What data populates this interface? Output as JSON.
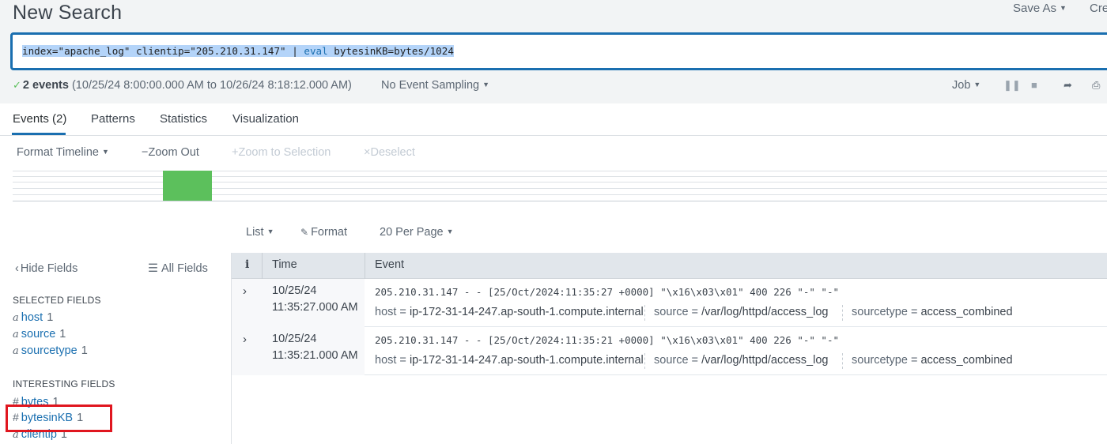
{
  "header": {
    "title": "New Search",
    "save_as": "Save As",
    "create": "Cre"
  },
  "search": {
    "query_part1": "index=\"apache_log\" clientip=\"205.210.31.147\" | ",
    "query_kw": "eval",
    "query_part2": " bytesinKB=bytes/1024"
  },
  "status": {
    "count": "2 events",
    "range": " (10/25/24 8:00:00.000 AM to 10/26/24 8:18:12.000 AM)",
    "sampling": "No Event Sampling",
    "job": "Job"
  },
  "tabs": [
    {
      "label": "Events (2)"
    },
    {
      "label": "Patterns"
    },
    {
      "label": "Statistics"
    },
    {
      "label": "Visualization"
    }
  ],
  "timeline": {
    "format": "Format Timeline",
    "zoom_out": "Zoom Out",
    "zoom_selection": "Zoom to Selection",
    "deselect": "Deselect"
  },
  "results_toolbar": {
    "list": "List",
    "format": "Format",
    "per_page": "20 Per Page"
  },
  "sidebar": {
    "hide_fields": "Hide Fields",
    "all_fields": "All Fields",
    "selected_title": "SELECTED FIELDS",
    "selected": [
      {
        "type": "a",
        "name": "host",
        "count": "1"
      },
      {
        "type": "a",
        "name": "source",
        "count": "1"
      },
      {
        "type": "a",
        "name": "sourcetype",
        "count": "1"
      }
    ],
    "interesting_title": "INTERESTING FIELDS",
    "interesting": [
      {
        "type": "#",
        "name": "bytes",
        "count": "1"
      },
      {
        "type": "#",
        "name": "bytesinKB",
        "count": "1"
      },
      {
        "type": "a",
        "name": "clientip",
        "count": "1"
      }
    ]
  },
  "table": {
    "col_i": "i",
    "col_time": "Time",
    "col_event": "Event",
    "rows": [
      {
        "date": "10/25/24",
        "time": "11:35:27.000 AM",
        "raw": "205.210.31.147 - - [25/Oct/2024:11:35:27 +0000] \"\\x16\\x03\\x01\" 400 226 \"-\" \"-\"",
        "host_label": "host =",
        "host": "ip-172-31-14-247.ap-south-1.compute.internal",
        "source_label": "source =",
        "source": "/var/log/httpd/access_log",
        "sourcetype_label": "sourcetype =",
        "sourcetype": "access_combined"
      },
      {
        "date": "10/25/24",
        "time": "11:35:21.000 AM",
        "raw": "205.210.31.147 - - [25/Oct/2024:11:35:21 +0000] \"\\x16\\x03\\x01\" 400 226 \"-\" \"-\"",
        "host_label": "host =",
        "host": "ip-172-31-14-247.ap-south-1.compute.internal",
        "source_label": "source =",
        "source": "/var/log/httpd/access_log",
        "sourcetype_label": "sourcetype =",
        "sourcetype": "access_combined"
      }
    ]
  },
  "colors": {
    "accent": "#1a6fb0",
    "timeline_bar": "#5cc05c",
    "highlight": "#e0161f"
  }
}
